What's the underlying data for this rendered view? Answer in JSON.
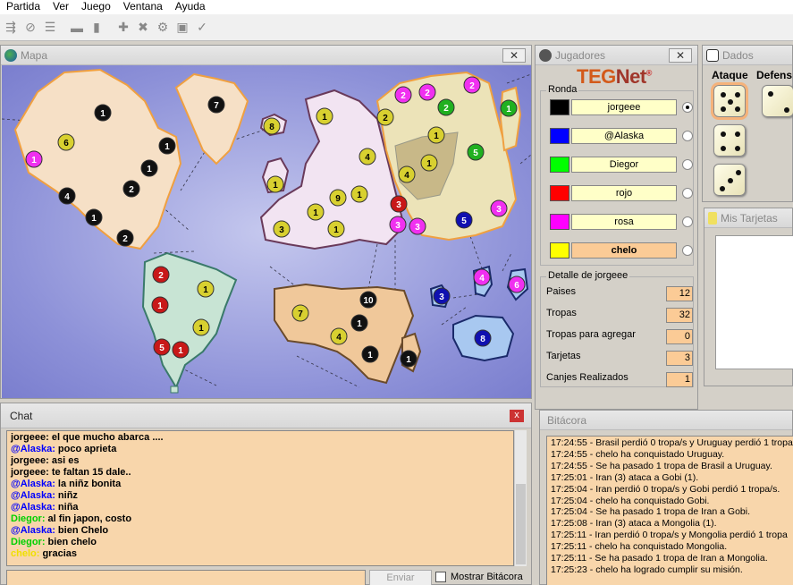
{
  "menu": [
    "Partida",
    "Ver",
    "Juego",
    "Ventana",
    "Ayuda"
  ],
  "map": {
    "title": "Mapa",
    "armies": [
      {
        "color": "black",
        "count": "1"
      },
      {
        "color": "black",
        "count": "7"
      },
      {
        "color": "yellow",
        "count": "8"
      },
      {
        "color": "magenta",
        "count": "1"
      },
      {
        "color": "yellow",
        "count": "6"
      },
      {
        "color": "black",
        "count": "1"
      },
      {
        "color": "black",
        "count": "1"
      },
      {
        "color": "black",
        "count": "2"
      },
      {
        "color": "black",
        "count": "4"
      },
      {
        "color": "black",
        "count": "1"
      },
      {
        "color": "black",
        "count": "2"
      },
      {
        "color": "magenta",
        "count": "2"
      },
      {
        "color": "magenta",
        "count": "2"
      },
      {
        "color": "magenta",
        "count": "2"
      },
      {
        "color": "yellow",
        "count": "1"
      },
      {
        "color": "yellow",
        "count": "2"
      },
      {
        "color": "green",
        "count": "2"
      },
      {
        "color": "green",
        "count": "1"
      },
      {
        "color": "yellow",
        "count": "4"
      },
      {
        "color": "yellow",
        "count": "1"
      },
      {
        "color": "yellow",
        "count": "4"
      },
      {
        "color": "yellow",
        "count": "1"
      },
      {
        "color": "green",
        "count": "5"
      },
      {
        "color": "magenta",
        "count": "3"
      },
      {
        "color": "blue",
        "count": "5"
      },
      {
        "color": "red",
        "count": "3"
      },
      {
        "color": "magenta",
        "count": "3"
      },
      {
        "color": "magenta",
        "count": "3"
      },
      {
        "color": "yellow",
        "count": "1"
      },
      {
        "color": "yellow",
        "count": "1"
      },
      {
        "color": "yellow",
        "count": "9"
      },
      {
        "color": "yellow",
        "count": "1"
      },
      {
        "color": "yellow",
        "count": "3"
      },
      {
        "color": "yellow",
        "count": "1"
      },
      {
        "color": "red",
        "count": "2"
      },
      {
        "color": "yellow",
        "count": "1"
      },
      {
        "color": "red",
        "count": "1"
      },
      {
        "color": "yellow",
        "count": "1"
      },
      {
        "color": "red",
        "count": "5"
      },
      {
        "color": "red",
        "count": "1"
      },
      {
        "color": "black",
        "count": "10"
      },
      {
        "color": "yellow",
        "count": "7"
      },
      {
        "color": "black",
        "count": "1"
      },
      {
        "color": "yellow",
        "count": "4"
      },
      {
        "color": "black",
        "count": "1"
      },
      {
        "color": "black",
        "count": "1"
      },
      {
        "color": "blue",
        "count": "3"
      },
      {
        "color": "magenta",
        "count": "4"
      },
      {
        "color": "magenta",
        "count": "6"
      },
      {
        "color": "blue",
        "count": "8"
      }
    ]
  },
  "players_panel": {
    "title": "Jugadores",
    "logo_a": "TEG",
    "logo_b": "Net",
    "logo_mark": "®",
    "ronda_label": "Ronda",
    "players": [
      {
        "name": "jorgeee",
        "color": "#000000",
        "selected": true
      },
      {
        "name": "@Alaska",
        "color": "#0000ff",
        "selected": false
      },
      {
        "name": "Diegor",
        "color": "#00ff00",
        "selected": false
      },
      {
        "name": "rojo",
        "color": "#ff0000",
        "selected": false
      },
      {
        "name": "rosa",
        "color": "#ff00ff",
        "selected": false
      },
      {
        "name": "chelo",
        "color": "#ffff00",
        "selected": false,
        "active": true
      }
    ],
    "detail_label": "Detalle de jorgeee",
    "details": [
      {
        "label": "Paises",
        "value": "12"
      },
      {
        "label": "Tropas",
        "value": "32"
      },
      {
        "label": "Tropas para agregar",
        "value": "0"
      },
      {
        "label": "Tarjetas",
        "value": "3"
      },
      {
        "label": "Canjes Realizados",
        "value": "1"
      }
    ]
  },
  "dice": {
    "title": "Dados",
    "attack_label": "Ataque",
    "defense_label": "Defens",
    "attack": [
      5,
      4,
      3
    ],
    "defense": [
      2
    ]
  },
  "cards": {
    "title": "Mis Tarjetas"
  },
  "chat": {
    "title": "Chat",
    "close": "x",
    "messages": [
      {
        "user": "jorgeee",
        "color": "#000000",
        "text": "el que mucho abarca ...."
      },
      {
        "user": "@Alaska",
        "color": "#0000ff",
        "text": "poco aprieta"
      },
      {
        "user": "jorgeee",
        "color": "#000000",
        "text": "asi es"
      },
      {
        "user": "jorgeee",
        "color": "#000000",
        "text": "te faltan 15 dale.."
      },
      {
        "user": "@Alaska",
        "color": "#0000ff",
        "text": "la niñz bonita"
      },
      {
        "user": "@Alaska",
        "color": "#0000ff",
        "text": "niñz"
      },
      {
        "user": "@Alaska",
        "color": "#0000ff",
        "text": "niña"
      },
      {
        "user": "Diegor",
        "color": "#00d000",
        "text": "al fin japon, costo"
      },
      {
        "user": "@Alaska",
        "color": "#0000ff",
        "text": "bien Chelo"
      },
      {
        "user": "Diegor",
        "color": "#00d000",
        "text": "bien chelo"
      },
      {
        "user": "chelo",
        "color": "#f0e000",
        "text": "gracias"
      }
    ],
    "send_label": "Enviar",
    "show_log_label": "Mostrar Bitácora"
  },
  "log": {
    "title": "Bitácora",
    "entries": [
      "17:24:55 - Brasil perdió 0 tropa/s y Uruguay perdió 1 tropa",
      "17:24:55 - chelo ha conquistado Uruguay.",
      "17:24:55 - Se ha pasado 1 tropa de Brasil a Uruguay.",
      "17:25:01 - Iran (3) ataca a Gobi (1).",
      "17:25:04 - Iran perdió 0 tropa/s y Gobi perdió 1 tropa/s.",
      "17:25:04 - chelo ha conquistado Gobi.",
      "17:25:04 - Se ha pasado 1 tropa de Iran a Gobi.",
      "17:25:08 - Iran (3) ataca a Mongolia (1).",
      "17:25:11 - Iran perdió 0 tropa/s y Mongolia perdió 1 tropa",
      "17:25:11 - chelo ha conquistado Mongolia.",
      "17:25:11 - Se ha pasado 1 tropa de Iran a Mongolia.",
      "17:25:23 - chelo ha logrado cumplir su misión."
    ]
  }
}
